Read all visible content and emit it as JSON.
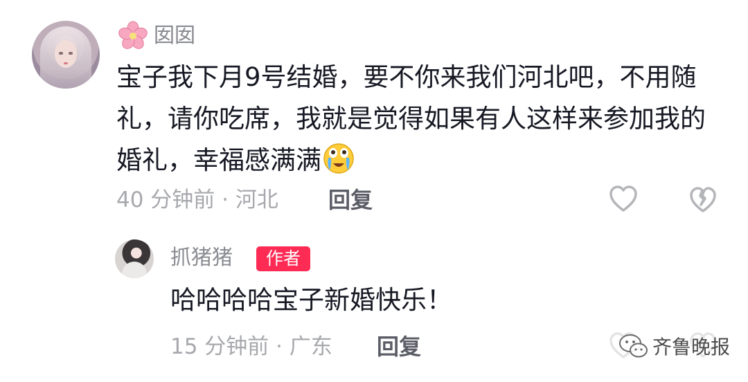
{
  "comment": {
    "username": "囡囡",
    "text": "宝子我下月9号结婚，要不你来我们河北吧，不用随礼，请你吃席，我就是觉得如果有人这样来参加我的婚礼，幸福感满满",
    "emoji": "crying-face-emoji",
    "meta": "40 分钟前 · 河北",
    "reply_label": "回复"
  },
  "reply": {
    "username": "抓猪猪",
    "badge": "作者",
    "text": "哈哈哈哈宝子新婚快乐！",
    "meta": "15 分钟前 · 广东",
    "reply_label": "回复"
  },
  "watermark": {
    "text": "齐鲁晚报"
  },
  "colors": {
    "badge": "#fe2c55",
    "meta": "#a7a8ad",
    "username": "#8a8b91",
    "text": "#161823"
  }
}
